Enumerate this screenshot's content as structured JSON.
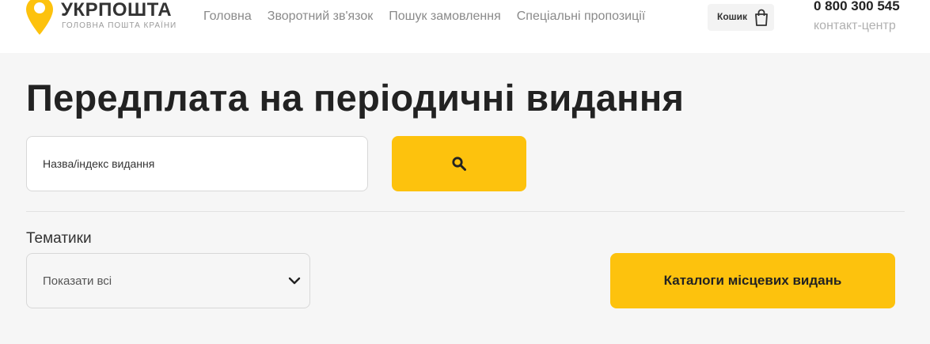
{
  "header": {
    "logo": {
      "title": "УКРПОШТА",
      "subtitle": "ГОЛОВНА ПОШТА КРАЇНИ",
      "icon": "location-pin-icon"
    },
    "nav": [
      {
        "label": "Головна"
      },
      {
        "label": "Зворотний зв'язок"
      },
      {
        "label": "Пошук замовлення"
      },
      {
        "label": "Спеціальні пропозиції"
      }
    ],
    "cart": {
      "label": "Кошик",
      "icon": "shopping-bag-icon"
    },
    "phone": "0 800 300 545",
    "contact_label": "контакт-центр"
  },
  "main": {
    "title": "Передплата на періодичні видання",
    "search": {
      "placeholder": "Назва/індекс видання",
      "value": "",
      "button_icon": "search-icon"
    },
    "topics": {
      "label": "Тематики",
      "selected": "Показати всі",
      "icon": "chevron-down-icon"
    },
    "catalog_button": "Каталоги місцевих видань"
  },
  "colors": {
    "accent": "#fdc20d",
    "page_background": "#f6f6f6",
    "header_background": "#ffffff",
    "text": "#222222",
    "muted_text": "#8a8a8a"
  }
}
